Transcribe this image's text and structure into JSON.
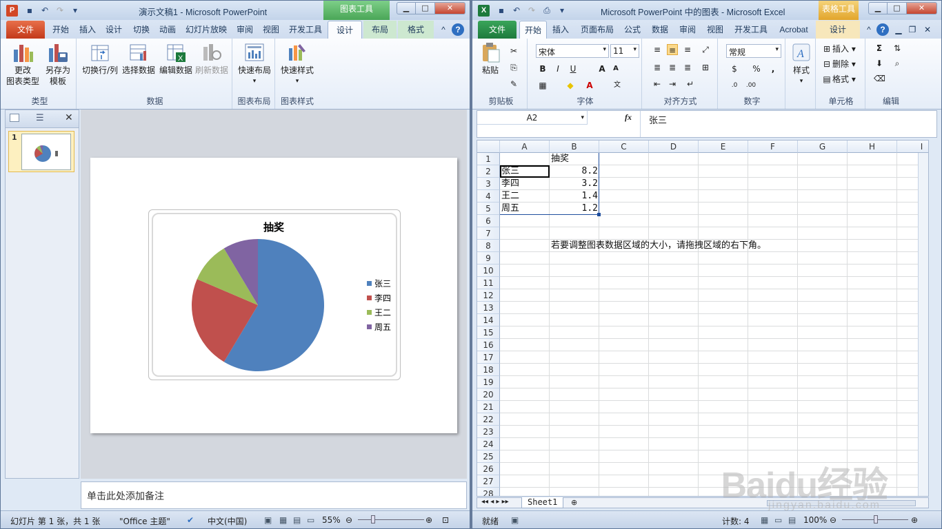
{
  "ppt": {
    "title": "演示文稿1 - Microsoft PowerPoint",
    "context_tab_group": "图表工具",
    "tabs": [
      "文件",
      "开始",
      "插入",
      "设计",
      "切换",
      "动画",
      "幻灯片放映",
      "审阅",
      "视图",
      "开发工具",
      "设计",
      "布局",
      "格式"
    ],
    "active_tab": "设计",
    "ribbon": {
      "groups": [
        {
          "label": "类型",
          "buttons": [
            {
              "label": "更改\n图表类型"
            },
            {
              "label": "另存为\n模板"
            }
          ]
        },
        {
          "label": "数据",
          "buttons": [
            {
              "label": "切换行/列"
            },
            {
              "label": "选择数据"
            },
            {
              "label": "编辑数据"
            },
            {
              "label": "刷新数据",
              "disabled": true
            }
          ]
        },
        {
          "label": "图表布局",
          "buttons": [
            {
              "label": "快速布局"
            }
          ]
        },
        {
          "label": "图表样式",
          "buttons": [
            {
              "label": "快速样式"
            }
          ]
        }
      ]
    },
    "slide_number": "1",
    "notes_placeholder": "单击此处添加备注",
    "status": {
      "slide_info": "幻灯片 第 1 张，共 1 张",
      "theme": "\"Office 主题\"",
      "language": "中文(中国)",
      "zoom": "55%"
    }
  },
  "chart_data": {
    "type": "pie",
    "title": "抽奖",
    "categories": [
      "张三",
      "李四",
      "王二",
      "周五"
    ],
    "values": [
      8.2,
      3.2,
      1.4,
      1.2
    ],
    "colors": [
      "#4f81bd",
      "#c0504d",
      "#9bbb59",
      "#8064a2"
    ],
    "legend": "right"
  },
  "excel": {
    "title": "Microsoft PowerPoint 中的图表 - Microsoft Excel",
    "context_tab_group": "表格工具",
    "tabs": [
      "文件",
      "开始",
      "插入",
      "页面布局",
      "公式",
      "数据",
      "审阅",
      "视图",
      "开发工具",
      "Acrobat",
      "设计"
    ],
    "active_tab": "开始",
    "font_name": "宋体",
    "font_size": "11",
    "number_format": "常规",
    "ribbon_labels": {
      "paste": "粘贴",
      "clipboard": "剪贴板",
      "font": "字体",
      "align": "对齐方式",
      "number": "数字",
      "styles": "样式",
      "cells": "单元格",
      "edit": "编辑",
      "insert": "插入",
      "delete": "删除",
      "format": "格式"
    },
    "name_box": "A2",
    "formula": "张三",
    "fx": "fx",
    "columns": [
      "A",
      "B",
      "C",
      "D",
      "E",
      "F",
      "G",
      "H",
      "I"
    ],
    "rows": [
      "1",
      "2",
      "3",
      "4",
      "5",
      "6",
      "7",
      "8",
      "9",
      "10",
      "11",
      "12",
      "13",
      "14",
      "15",
      "16",
      "17",
      "18",
      "19",
      "20",
      "21",
      "22",
      "23",
      "24",
      "25",
      "26",
      "27",
      "28"
    ],
    "cells": {
      "B1": "抽奖",
      "A2": "张三",
      "B2": "8.2",
      "A3": "李四",
      "B3": "3.2",
      "A4": "王二",
      "B4": "1.4",
      "A5": "周五",
      "B5": "1.2",
      "B8": "若要调整图表数据区域的大小，请拖拽区域的右下角。"
    },
    "sheet_tab": "Sheet1",
    "status": {
      "ready": "就绪",
      "count": "计数: 4",
      "zoom": "100%"
    }
  },
  "watermark": {
    "logo": "Baidu经验",
    "url": "jingyan.baidu.com"
  }
}
